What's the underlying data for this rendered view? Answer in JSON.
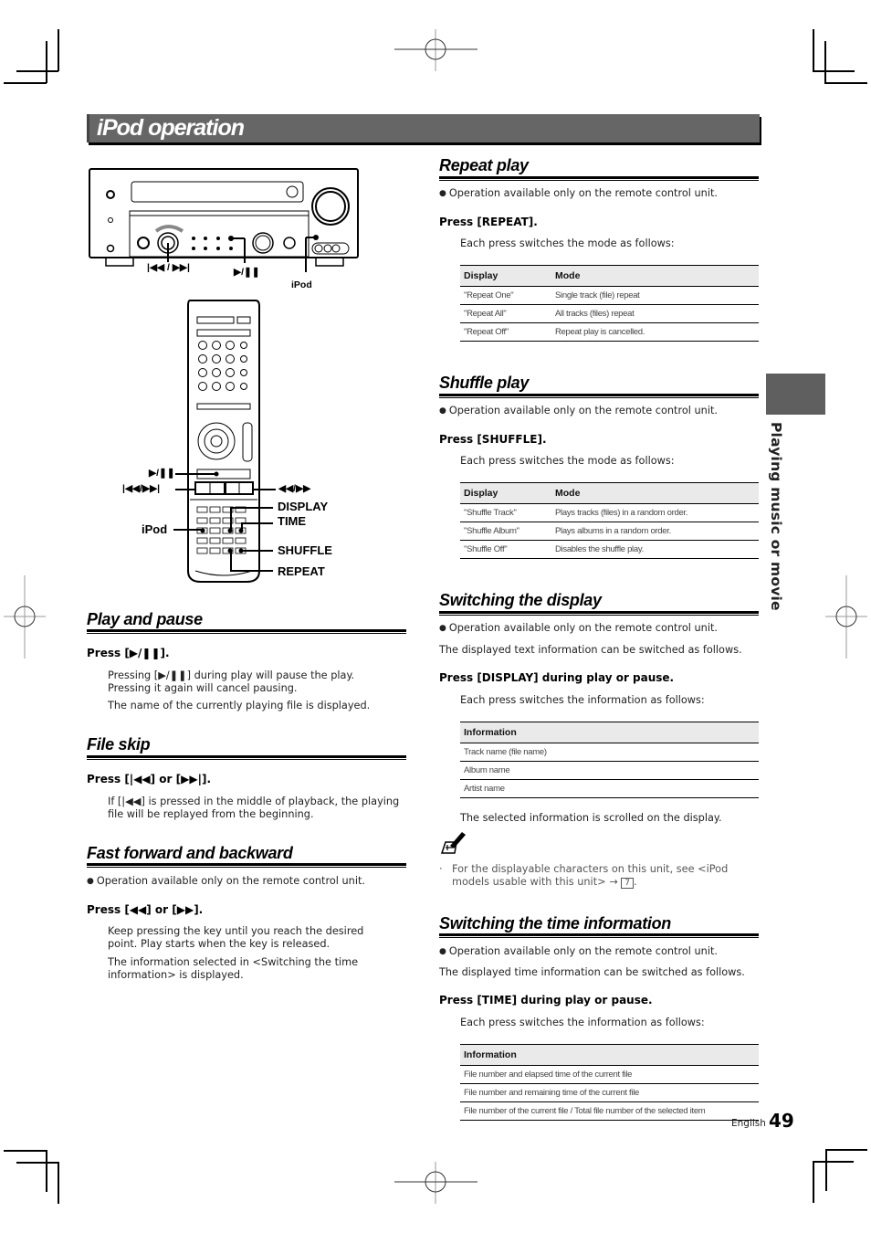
{
  "page": {
    "title": "iPod operation",
    "side_tab": "Playing music or movie",
    "footer_lang": "English",
    "page_number": "49"
  },
  "figure": {
    "receiver_labels": {
      "skip": "|◀◀ / ▶▶|",
      "play_pause": "▶/❚❚",
      "ipod": "iPod"
    },
    "remote_labels": {
      "play_pause": "▶/❚❚",
      "skip": "|◀◀/▶▶|",
      "ff_rew": "◀◀/▶▶",
      "display": "DISPLAY",
      "time": "TIME",
      "ipod": "iPod",
      "shuffle": "SHUFFLE",
      "repeat": "REPEAT"
    }
  },
  "play_pause": {
    "heading": "Play and pause",
    "press": "Press [▶/❚❚].",
    "text1": "Pressing [▶/❚❚] during play will pause the play. Pressing it again will cancel pausing.",
    "text2": "The name of the currently playing file is displayed."
  },
  "file_skip": {
    "heading": "File skip",
    "press": "Press [|◀◀] or [▶▶|].",
    "text1": "If [|◀◀] is pressed in the middle of playback, the playing file will be replayed from the beginning."
  },
  "ff_rew": {
    "heading": "Fast forward and backward",
    "note": "Operation available only on the remote control unit.",
    "press": "Press [◀◀] or [▶▶].",
    "text1": "Keep pressing the key until you reach the desired point. Play starts when the key is released.",
    "text2": "The information selected in <Switching the time information> is displayed."
  },
  "repeat": {
    "heading": "Repeat play",
    "note": "Operation available only on the remote control unit.",
    "press": "Press [REPEAT].",
    "intro": "Each press switches the mode as follows:",
    "columns": [
      "Display",
      "Mode"
    ],
    "rows": [
      [
        "\"Repeat  One\"",
        "Single track (file) repeat"
      ],
      [
        "\"Repeat  All\"",
        "All tracks (files) repeat"
      ],
      [
        "\"Repeat  Off\"",
        "Repeat play is cancelled."
      ]
    ]
  },
  "shuffle": {
    "heading": "Shuffle play",
    "note": "Operation available only on the remote control unit.",
    "press": "Press [SHUFFLE].",
    "intro": "Each press switches the mode as follows:",
    "columns": [
      "Display",
      "Mode"
    ],
    "rows": [
      [
        "\"Shuffle  Track\"",
        "Plays tracks (files) in a random order."
      ],
      [
        "\"Shuffle  Album\"",
        "Plays albums in a random order."
      ],
      [
        "\"Shuffle  Off\"",
        "Disables the shuffle play."
      ]
    ]
  },
  "display": {
    "heading": "Switching the display",
    "note": "Operation available only on the remote control unit.",
    "text": "The displayed text information can be switched as follows.",
    "press": "Press [DISPLAY] during play or pause.",
    "intro": "Each press switches the information as follows:",
    "columns": [
      "Information"
    ],
    "rows": [
      [
        "Track name (file name)"
      ],
      [
        "Album name"
      ],
      [
        "Artist name"
      ]
    ],
    "after": "The selected information is scrolled on the display.",
    "memo": "For the displayable characters on this unit, see <iPod models usable with this unit>",
    "memo_ref": "7"
  },
  "time": {
    "heading": "Switching the time information",
    "note": "Operation available only on the remote control unit.",
    "text": "The displayed time information can be switched as follows.",
    "press": "Press [TIME] during play or pause.",
    "intro": "Each press switches the information as follows:",
    "columns": [
      "Information"
    ],
    "rows": [
      [
        "File number and elapsed time of the current file"
      ],
      [
        "File number and remaining time of the current file"
      ],
      [
        "File number of the current file / Total file number of the selected item"
      ]
    ]
  }
}
